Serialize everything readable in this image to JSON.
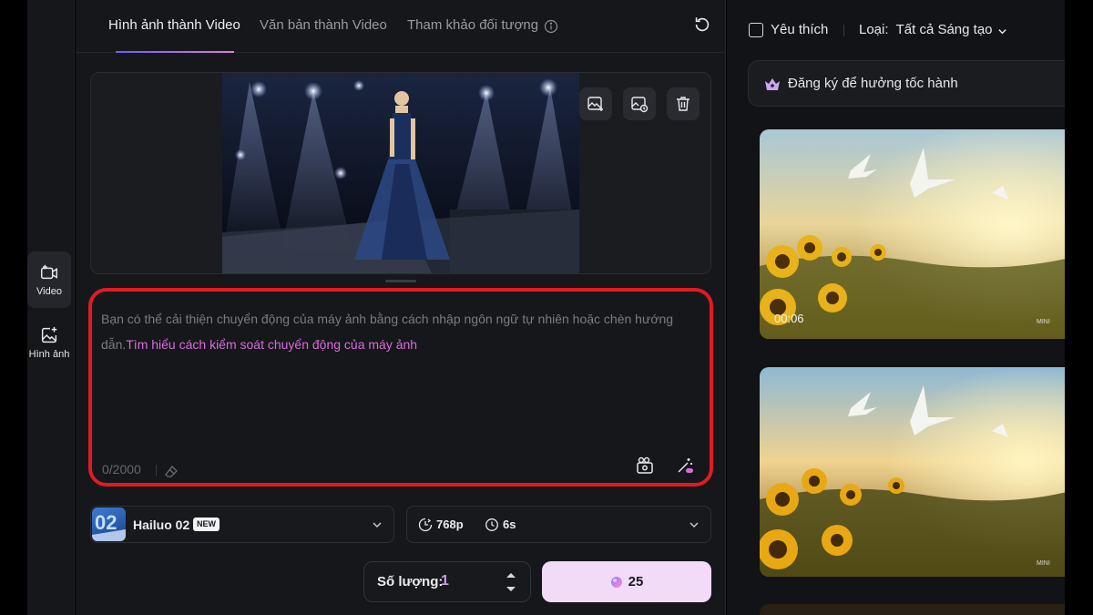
{
  "nav": {
    "items": [
      {
        "label": "Video",
        "icon": "video-add-icon"
      },
      {
        "label": "Hình ảnh",
        "icon": "image-add-icon"
      }
    ]
  },
  "tabs": {
    "items": [
      "Hình ảnh thành Video",
      "Văn bản thành Video",
      "Tham khảo đối tượng"
    ],
    "active": 0
  },
  "prompt": {
    "placeholder": "Bạn có thể cải thiện chuyển động của máy ảnh bằng cách nhập ngôn ngữ tự nhiên hoặc chèn hướng dẫn.",
    "link": "Tìm hiểu cách kiểm soát chuyển động của máy ảnh",
    "counter": "0/2000"
  },
  "model": {
    "name": "Hailuo 02",
    "badge": "NEW"
  },
  "settings": {
    "resolution": "768p",
    "duration": "6s"
  },
  "quantity": {
    "label": "Số lượng:",
    "value": "1"
  },
  "generate": {
    "cost": "25"
  },
  "filters": {
    "favorite_label": "Yêu thích",
    "type_label": "Loại:",
    "type_value": "Tất cả Sáng tạo"
  },
  "subscribe": {
    "text": "Đăng ký để hưởng tốc hành"
  },
  "gallery": [
    {
      "duration": "00:06",
      "watermark": "MINI"
    },
    {
      "duration": "",
      "watermark": "MINI"
    }
  ],
  "colors": {
    "accent_link": "#d96bdc",
    "highlight_border": "#e01b22",
    "generate_bg": "#f1dbf7",
    "quantity_value": "#c79be8"
  }
}
